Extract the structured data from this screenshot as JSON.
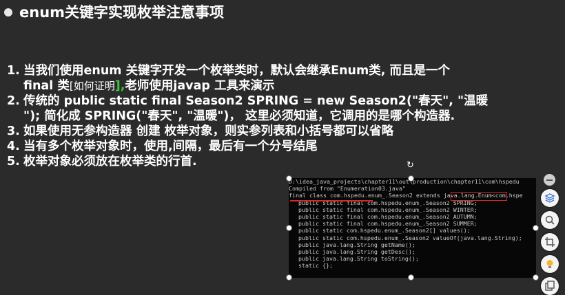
{
  "slide": {
    "title": "enum关键字实现枚举注意事项"
  },
  "items": [
    {
      "num": "1.",
      "line1": "当我们使用enum 关键字开发一个枚举类时，默认会继承Enum类, 而且是一个",
      "line2_a": "final 类",
      "line2_b": "[如何证明",
      "line2_c": "],",
      "line2_d": "老师使用javap 工具来演示"
    },
    {
      "num": "2.",
      "line1": "传统的 public static final Season2 SPRING = new Season2(\"春天\", \"温暖",
      "line2": "\"); 简化成 SPRING(\"春天\", \"温暖\")，  这里必须知道，它调用的是哪个构造器."
    },
    {
      "num": "3.",
      "line1": "如果使用无参构造器 创建 枚举对象，则实参列表和小括号都可以省略"
    },
    {
      "num": "4.",
      "line1": "当有多个枚举对象时，使用,间隔，最后有一个分号结尾"
    },
    {
      "num": "5.",
      "line1": "枚举对象必须放在枚举类的行首."
    }
  ],
  "terminal": {
    "lines": [
      "D:\\idea_java_projects\\chapter11\\out\\production\\chapter11\\com\\hspedu",
      "Compiled from \"Enumeration03.java\"",
      "final class com.hspedu.enum_.Season2 extends java.lang.Enum<com.hspe",
      "public static final com.hspedu.enum_.Season2 SPRING;",
      "public static final com.hspedu.enum_.Season2 WINTER;",
      "public static final com.hspedu.enum_.Season2 AUTUMN;",
      "public static final com.hspedu.enum_.Season2 SUMMER;",
      "public static com.hspedu.enum_.Season2[] values();",
      "public static com.hspedu.enum_.Season2 valueOf(java.lang.String);",
      "public java.lang.String getName();",
      "public java.lang.String getDesc();",
      "public java.lang.String toString();",
      "static {};"
    ]
  },
  "colors": {
    "background": "#2b2b2b",
    "text": "#ffffff",
    "accent_green": "#3cc43c",
    "highlight_red": "#d92828",
    "terminal_bg": "#070707"
  },
  "toolbar": {
    "icons": [
      "minus-icon",
      "layers-icon",
      "zoom-icon",
      "crop-icon",
      "lightbulb-icon",
      "copy-icon"
    ]
  }
}
